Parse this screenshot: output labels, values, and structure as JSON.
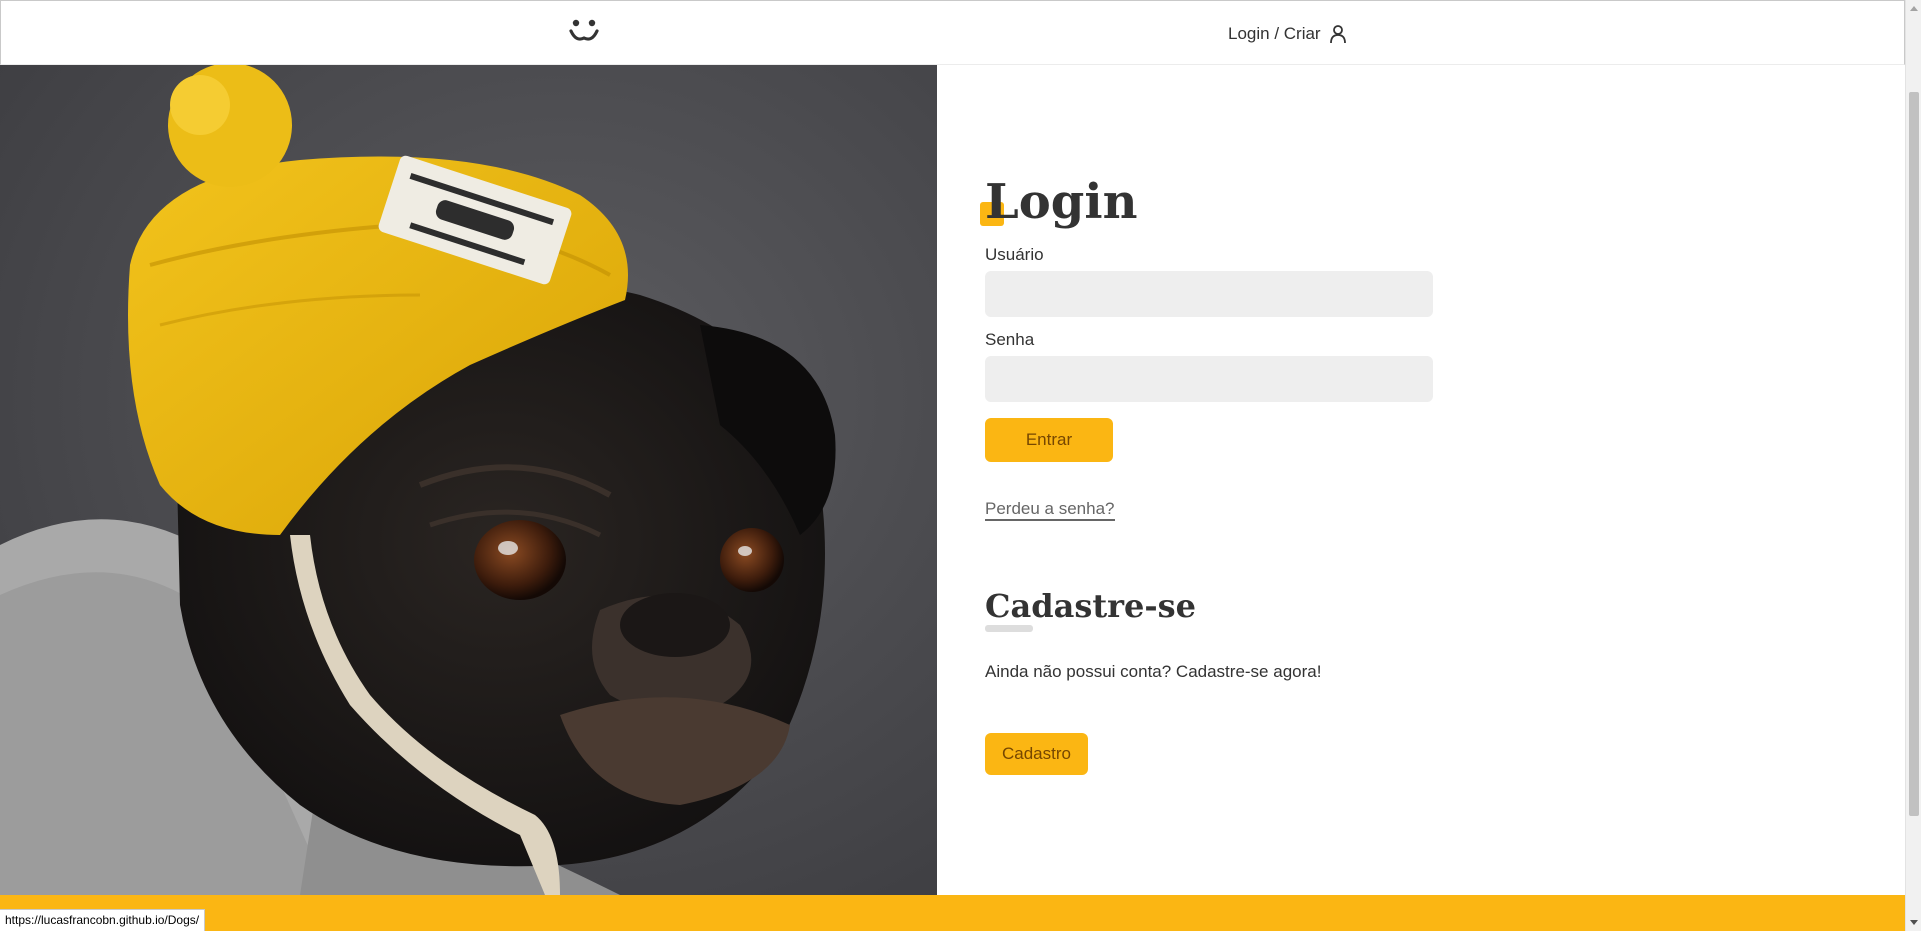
{
  "header": {
    "login_label": "Login / Criar"
  },
  "login": {
    "title": "Login",
    "username_label": "Usuário",
    "password_label": "Senha",
    "username_value": "",
    "password_value": "",
    "submit_label": "Entrar",
    "forgot_label": "Perdeu a senha?"
  },
  "signup": {
    "title": "Cadastre-se",
    "text": "Ainda não possui conta? Cadastre-se agora!",
    "button_label": "Cadastro"
  },
  "status_bar": {
    "url": "https://lucasfrancobn.github.io/Dogs/"
  },
  "colors": {
    "accent": "#fbb613",
    "accent_text": "#764701",
    "text": "#333333",
    "input_bg": "#eeeeee"
  },
  "icons": {
    "logo": "dog-face-icon",
    "user": "user-icon"
  }
}
